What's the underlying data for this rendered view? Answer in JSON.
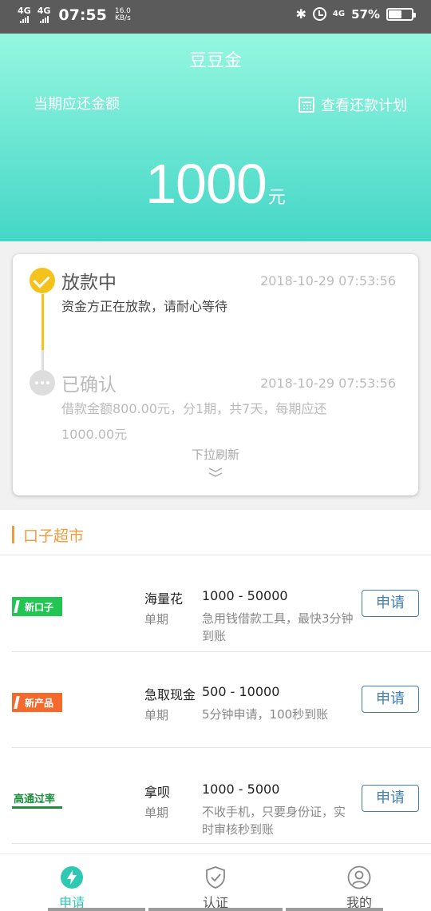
{
  "status_bar": {
    "sim1": "4G",
    "sim2": "4G",
    "time": "07:55",
    "speed_value": "16.0",
    "speed_unit": "KB/s",
    "network": "4G",
    "battery_pct": "57%",
    "battery_level": 0.57
  },
  "header": {
    "title": "豆豆金",
    "due_label": "当期应还金额",
    "plan_link": "查看还款计划",
    "amount": "1000",
    "amount_unit": "元"
  },
  "timeline": {
    "steps": [
      {
        "title": "放款中",
        "time": "2018-10-29 07:53:56",
        "desc": "资金方正在放款，请耐心等待"
      },
      {
        "title": "已确认",
        "time": "2018-10-29 07:53:56",
        "desc": "借款金额800.00元，分1期，共7天，每期应还1000.00元"
      }
    ],
    "pull_hint": "下拉刷新"
  },
  "market": {
    "title": "口子超市",
    "items": [
      {
        "logo": "新口子",
        "name": "海量花",
        "period": "单期",
        "range": "1000 - 50000",
        "desc": "急用钱借款工具，最快3分钟到账",
        "button": "申请"
      },
      {
        "logo": "新产品",
        "name": "急取现金",
        "period": "单期",
        "range": "500 - 10000",
        "desc": "5分钟申请，100秒到账",
        "button": "申请"
      },
      {
        "logo": "高通过率",
        "name": "拿呗",
        "period": "单期",
        "range": "1000 - 5000",
        "desc": "不收手机，只要身份证，实时审核秒到账",
        "button": "申请"
      }
    ]
  },
  "nav": {
    "tabs": [
      {
        "label": "申请",
        "icon": "lightning-icon"
      },
      {
        "label": "认证",
        "icon": "shield-check-icon"
      },
      {
        "label": "我的",
        "icon": "user-icon"
      }
    ]
  },
  "colors": {
    "accent": "#44d6c6",
    "active_step": "#f5c21b",
    "section_title": "#f39a3b",
    "apply_button": "#3f7fb3"
  }
}
